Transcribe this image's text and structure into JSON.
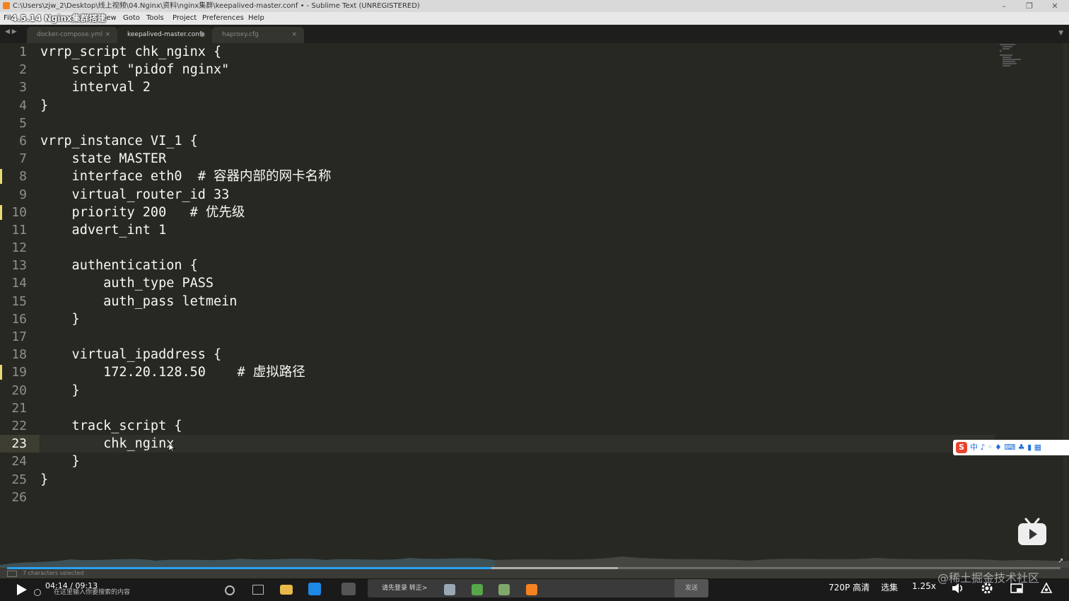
{
  "window": {
    "title": "C:\\Users\\zjw_2\\Desktop\\线上视频\\04.Nginx\\资料\\nginx集群\\keepalived-master.conf • - Sublime Text (UNREGISTERED)",
    "minimize": "–",
    "maximize": "❐",
    "close": "✕"
  },
  "video": {
    "title": "4.5.14 Nginx集群搭建",
    "time": "04:14 / 09:13",
    "quality": "720P 高清",
    "episodes": "选集",
    "speed": "1.25x",
    "progress_played": 0.46,
    "progress_buffered": 0.58,
    "danmaku_placeholder": "请先登录 转正>",
    "send_label": "发送",
    "watermark": "@稀土掘金技术社区"
  },
  "menu": {
    "file": "File",
    "view": "View",
    "goto": "Goto",
    "tools": "Tools",
    "project": "Project",
    "preferences": "Preferences",
    "help": "Help"
  },
  "tabs": [
    {
      "label": "docker-compose.yml",
      "close": "×"
    },
    {
      "label": "keepalived-master.conf",
      "close": "●"
    },
    {
      "label": "haproxy.cfg",
      "close": "×"
    }
  ],
  "editor": {
    "lines": [
      {
        "n": "1",
        "text": "vrrp_script chk_nginx {"
      },
      {
        "n": "2",
        "text": "    script \"pidof nginx\""
      },
      {
        "n": "3",
        "text": "    interval 2"
      },
      {
        "n": "4",
        "text": "}"
      },
      {
        "n": "5",
        "text": ""
      },
      {
        "n": "6",
        "text": "vrrp_instance VI_1 {"
      },
      {
        "n": "7",
        "text": "    state MASTER"
      },
      {
        "n": "8",
        "text": "    interface eth0  # 容器内部的网卡名称"
      },
      {
        "n": "9",
        "text": "    virtual_router_id 33"
      },
      {
        "n": "10",
        "text": "    priority 200   # 优先级"
      },
      {
        "n": "11",
        "text": "    advert_int 1"
      },
      {
        "n": "12",
        "text": ""
      },
      {
        "n": "13",
        "text": "    authentication {"
      },
      {
        "n": "14",
        "text": "        auth_type PASS"
      },
      {
        "n": "15",
        "text": "        auth_pass letmein"
      },
      {
        "n": "16",
        "text": "    }"
      },
      {
        "n": "17",
        "text": ""
      },
      {
        "n": "18",
        "text": "    virtual_ipaddress {"
      },
      {
        "n": "19",
        "text": "        172.20.128.50    # 虚拟路径"
      },
      {
        "n": "20",
        "text": "    }"
      },
      {
        "n": "21",
        "text": ""
      },
      {
        "n": "22",
        "text": "    track_script {"
      },
      {
        "n": "23",
        "text": "        chk_nginx"
      },
      {
        "n": "24",
        "text": "    }"
      },
      {
        "n": "25",
        "text": "}"
      },
      {
        "n": "26",
        "text": ""
      }
    ],
    "current_line": "23",
    "modified_lines": [
      "8",
      "10",
      "19"
    ]
  },
  "status": {
    "text": "7 characters selected"
  },
  "ime": {
    "text": "中 ♪ ◦ ♦ ⌨ ♣ ▮ ▦"
  },
  "taskbar": {
    "search_placeholder": "在这里输入你要搜索的内容"
  },
  "colors": {
    "editor_bg": "#272822",
    "text": "#f8f8f2",
    "gutter": "#90908a",
    "modified": "#e6db74",
    "progress": "#2aa2f0"
  }
}
